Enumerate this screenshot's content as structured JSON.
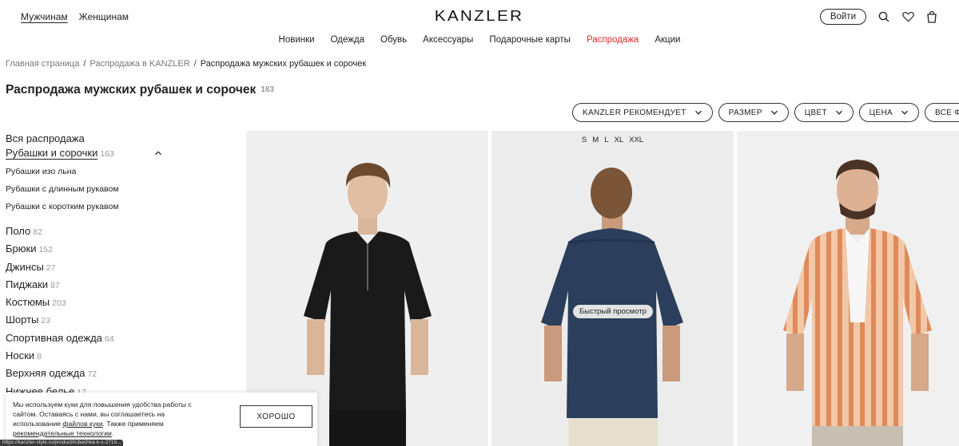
{
  "header": {
    "gender_tabs": [
      "Мужчинам",
      "Женщинам"
    ],
    "logo": "KANZLER",
    "login_label": "Войти"
  },
  "nav": [
    "Новинки",
    "Одежда",
    "Обувь",
    "Аксессуары",
    "Подарочные карты",
    "Распродажа",
    "Акции"
  ],
  "breadcrumb": [
    "Главная страница",
    "Распродажа в KANZLER",
    "Распродажа мужских рубашек и сорочек"
  ],
  "page": {
    "title": "Распродажа мужских рубашек и сорочек",
    "count": "163"
  },
  "filters": [
    "KANZLER РЕКОМЕНДУЕТ",
    "РАЗМЕР",
    "ЦВЕТ",
    "ЦЕНА",
    "ВСЕ ФИЛЬТРЫ"
  ],
  "sidebar": {
    "all_label": "Вся распродажа",
    "current": {
      "label": "Рубашки и сорочки",
      "count": "163"
    },
    "subcategories": [
      "Рубашки изо льна",
      "Рубашки с длинным рукавом",
      "Рубашки с коротким рукавом"
    ],
    "categories": [
      {
        "label": "Поло",
        "count": "82"
      },
      {
        "label": "Брюки",
        "count": "152"
      },
      {
        "label": "Джинсы",
        "count": "27"
      },
      {
        "label": "Пиджаки",
        "count": "87"
      },
      {
        "label": "Костюмы",
        "count": "203"
      },
      {
        "label": "Шорты",
        "count": "23"
      },
      {
        "label": "Спортивная одежда",
        "count": "64"
      },
      {
        "label": "Носки",
        "count": "8"
      },
      {
        "label": "Верхняя одежда",
        "count": "72"
      },
      {
        "label": "Нижнее белье",
        "count": "17"
      }
    ]
  },
  "products": {
    "sizes": [
      "S",
      "M",
      "L",
      "XL",
      "XXL"
    ],
    "quick_view": "Быстрый просмотр"
  },
  "cookie": {
    "text_1": "Мы используем куки для повышения удобства работы с сайтом. Оставаясь с нами, вы соглашаетесь на использование ",
    "link_1": "файлов куки",
    "text_2": ". Также применяем ",
    "link_2": "рекомендательные технологии",
    "text_3": ".",
    "button": "ХОРОШО"
  },
  "status_url": "https://kanzler-style.ru/product/rubashka-k-s-2715..."
}
